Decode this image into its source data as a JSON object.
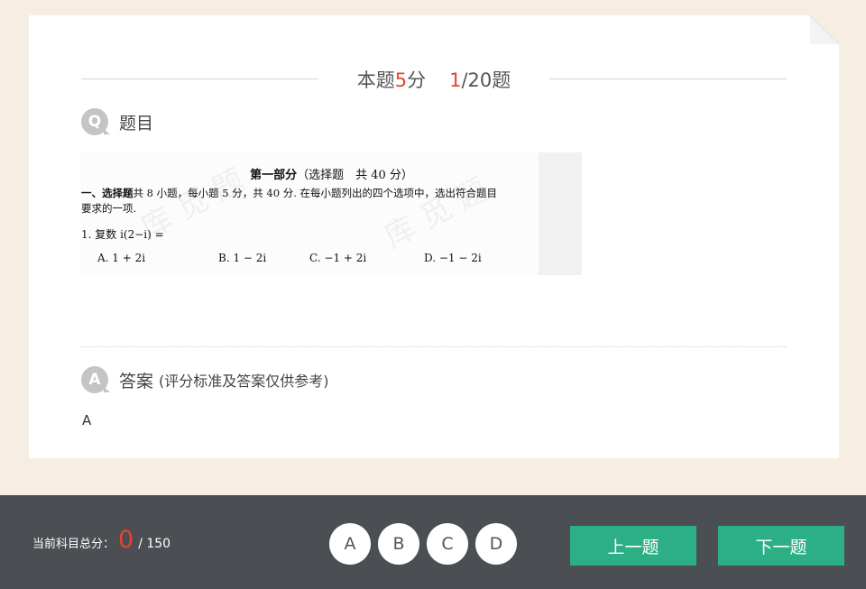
{
  "header": {
    "score_prefix": "本题",
    "score_value": "5",
    "score_suffix": "分",
    "current_index": "1",
    "total_suffix": "/20题"
  },
  "question": {
    "badge": "Q",
    "heading": "题目",
    "image": {
      "part_title": "第一部分",
      "part_detail": "（选择题　共 40 分）",
      "section_label": "一、选择题",
      "instruction_1": "共 8 小题，每小题 5 分，共 40 分. 在每小题列出的四个选项中，选出符合题目",
      "instruction_2": "要求的一项.",
      "stem": "1.  复数 i(2−i) =",
      "choices": [
        "A.  1 + 2i",
        "B.  1 − 2i",
        "C.  −1 + 2i",
        "D.  −1 − 2i"
      ]
    }
  },
  "answer": {
    "badge": "A",
    "heading": "答案",
    "subheading": "(评分标准及答案仅供参考)",
    "value": "A"
  },
  "footer": {
    "score_label": "当前科目总分：",
    "score_value": "0",
    "score_total": "/ 150",
    "options": [
      "A",
      "B",
      "C",
      "D"
    ],
    "prev_label": "上一题",
    "next_label": "下一题"
  },
  "colors": {
    "page_bg": "#f6eee2",
    "accent_red": "#e8432b",
    "button_green": "#2daf86",
    "footer_bg": "#4b4e53"
  }
}
